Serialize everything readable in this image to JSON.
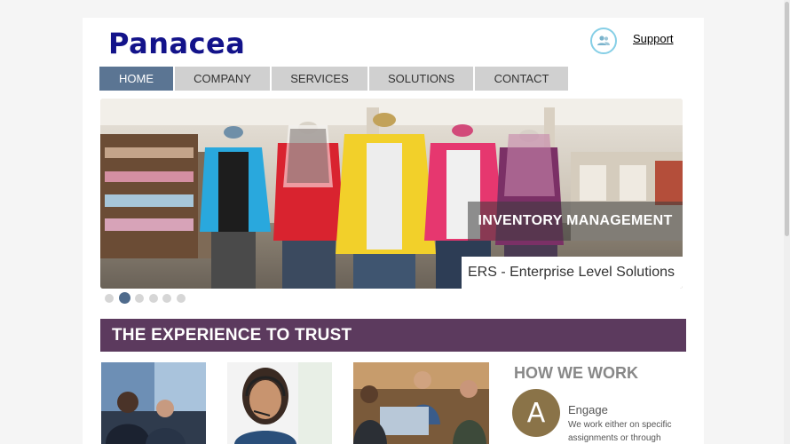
{
  "header": {
    "logo": "Panacea",
    "support_label": "Support"
  },
  "nav": {
    "items": [
      {
        "label": "HOME",
        "active": true
      },
      {
        "label": "COMPANY",
        "active": false
      },
      {
        "label": "SERVICES",
        "active": false
      },
      {
        "label": "SOLUTIONS",
        "active": false
      },
      {
        "label": "CONTACT",
        "active": false
      }
    ]
  },
  "banner": {
    "caption": "INVENTORY MANAGEMENT",
    "subcaption": "ERS - Enterprise Level Solutions",
    "slide_count": 6,
    "active_slide": 2
  },
  "section": {
    "title": "THE EXPERIENCE TO TRUST"
  },
  "how_we_work": {
    "title": "HOW WE WORK",
    "badge_letter": "A",
    "step_title": "Engage",
    "step_text": "We work either on specific assignments or through"
  },
  "colors": {
    "logo": "#13138a",
    "nav_active": "#5b7593",
    "nav_inactive": "#d0d0d0",
    "section_bar": "#5c3a5e",
    "badge": "#8a7348"
  }
}
